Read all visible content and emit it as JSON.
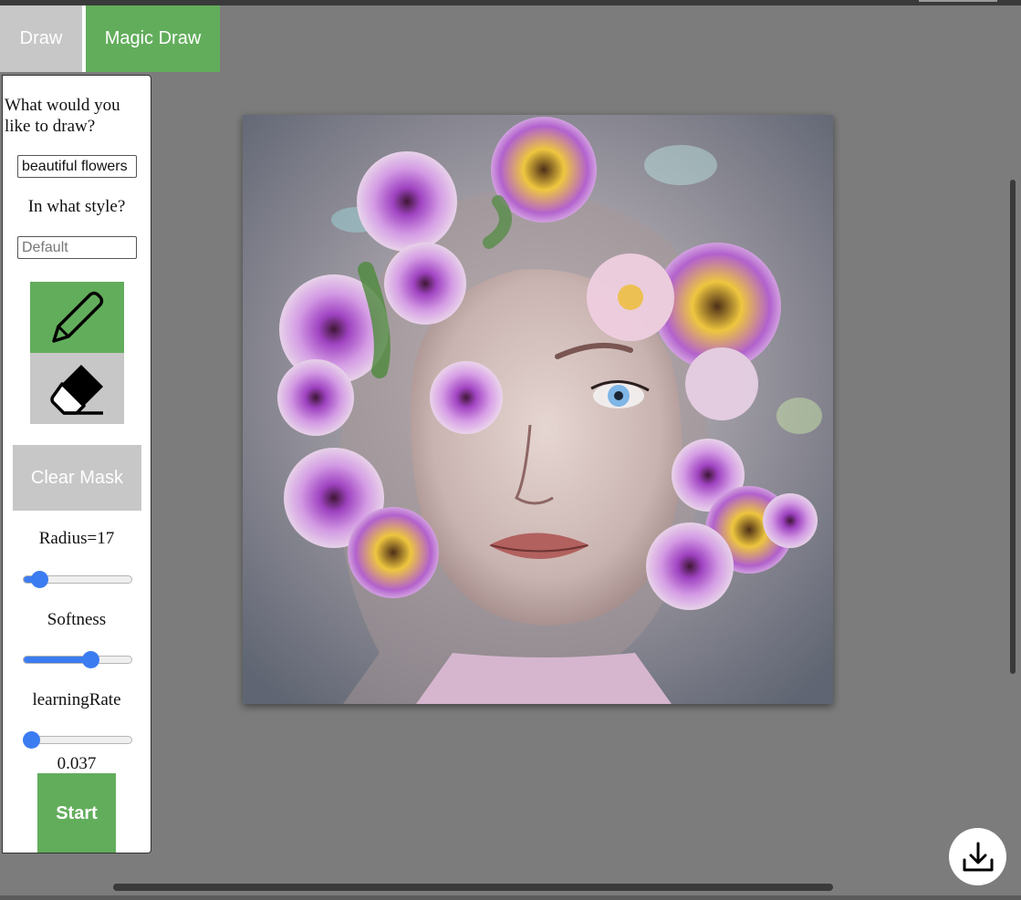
{
  "tabs": {
    "draw_label": "Draw",
    "magic_draw_label": "Magic Draw",
    "active": "Magic Draw"
  },
  "prompt": {
    "question": "What would you like to draw?",
    "value": "beautiful flowers"
  },
  "style": {
    "question": "In what style?",
    "placeholder": "Default",
    "value": ""
  },
  "tools": {
    "pencil_icon": "pencil-icon",
    "eraser_icon": "eraser-icon",
    "selected": "pencil"
  },
  "clear_mask_label": "Clear Mask",
  "sliders": {
    "radius": {
      "label": "Radius=17",
      "value": 17,
      "fraction": 0.15
    },
    "softness": {
      "label": "Softness",
      "fraction": 0.62
    },
    "learning_rate": {
      "label": "learningRate",
      "fraction": 0.05,
      "value_text": "0.037"
    }
  },
  "start_label": "Start",
  "download_icon": "download-icon",
  "colors": {
    "accent_green": "#62ad5b",
    "inactive_gray": "#c7c7c7",
    "slider_blue": "#3c7cf1",
    "background": "#7c7c7c"
  }
}
